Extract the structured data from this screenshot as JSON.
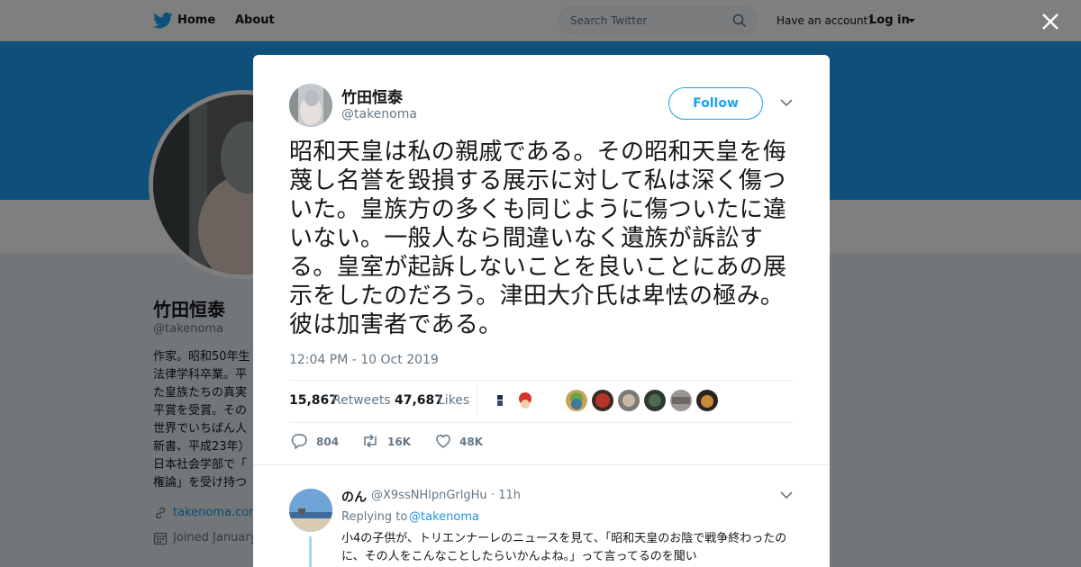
{
  "nav": {
    "home": "Home",
    "about": "About",
    "search_placeholder": "Search Twitter",
    "have_account": "Have an account?",
    "login": "Log in"
  },
  "profile": {
    "name": "竹田恒泰",
    "handle": "@takenoma",
    "bio_lines": [
      "作家。昭和50年生",
      "法律学科卒業。平",
      "た皇族たちの真実",
      "平賞を受賞。その",
      "世界でいちばん人",
      "新書、平成23年）",
      "日本社会学部で「",
      "権論」を受け持つ"
    ],
    "link": "takenoma.com",
    "joined": "Joined January"
  },
  "tweet": {
    "author_name": "竹田恒泰",
    "author_handle": "@takenoma",
    "follow_label": "Follow",
    "text": "昭和天皇は私の親戚である。その昭和天皇を侮蔑し名誉を毀損する展示に対して私は深く傷ついた。皇族方の多くも同じように傷ついたに違いない。一般人なら間違いなく遺族が訴訟する。皇室が起訴しないことを良いことにあの展示をしたのだろう。津田大介氏は卑怯の極み。彼は加害者である。",
    "timestamp": "12:04 PM - 10 Oct 2019",
    "retweets_count": "15,867",
    "retweets_label": "Retweets",
    "likes_count": "47,687",
    "likes_label": "Likes",
    "replies_action": "804",
    "retweets_action": "16K",
    "likes_action": "48K"
  },
  "reply": {
    "name": "のん",
    "handle": "@X9ssNHlpnGrlgHu",
    "time": "· 11h",
    "replying_label": "Replying to",
    "replying_to": "@takenoma",
    "text": "小4の子供が、トリエンナーレのニュースを見て、「昭和天皇のお陰で戦争終わったのに、その人をこんなことしたらいかんよね。」って言ってるのを聞い"
  },
  "colors": {
    "accent": "#1da1f2",
    "link": "#1b95e0",
    "muted": "#657786",
    "thread": "#a5d8f7"
  }
}
